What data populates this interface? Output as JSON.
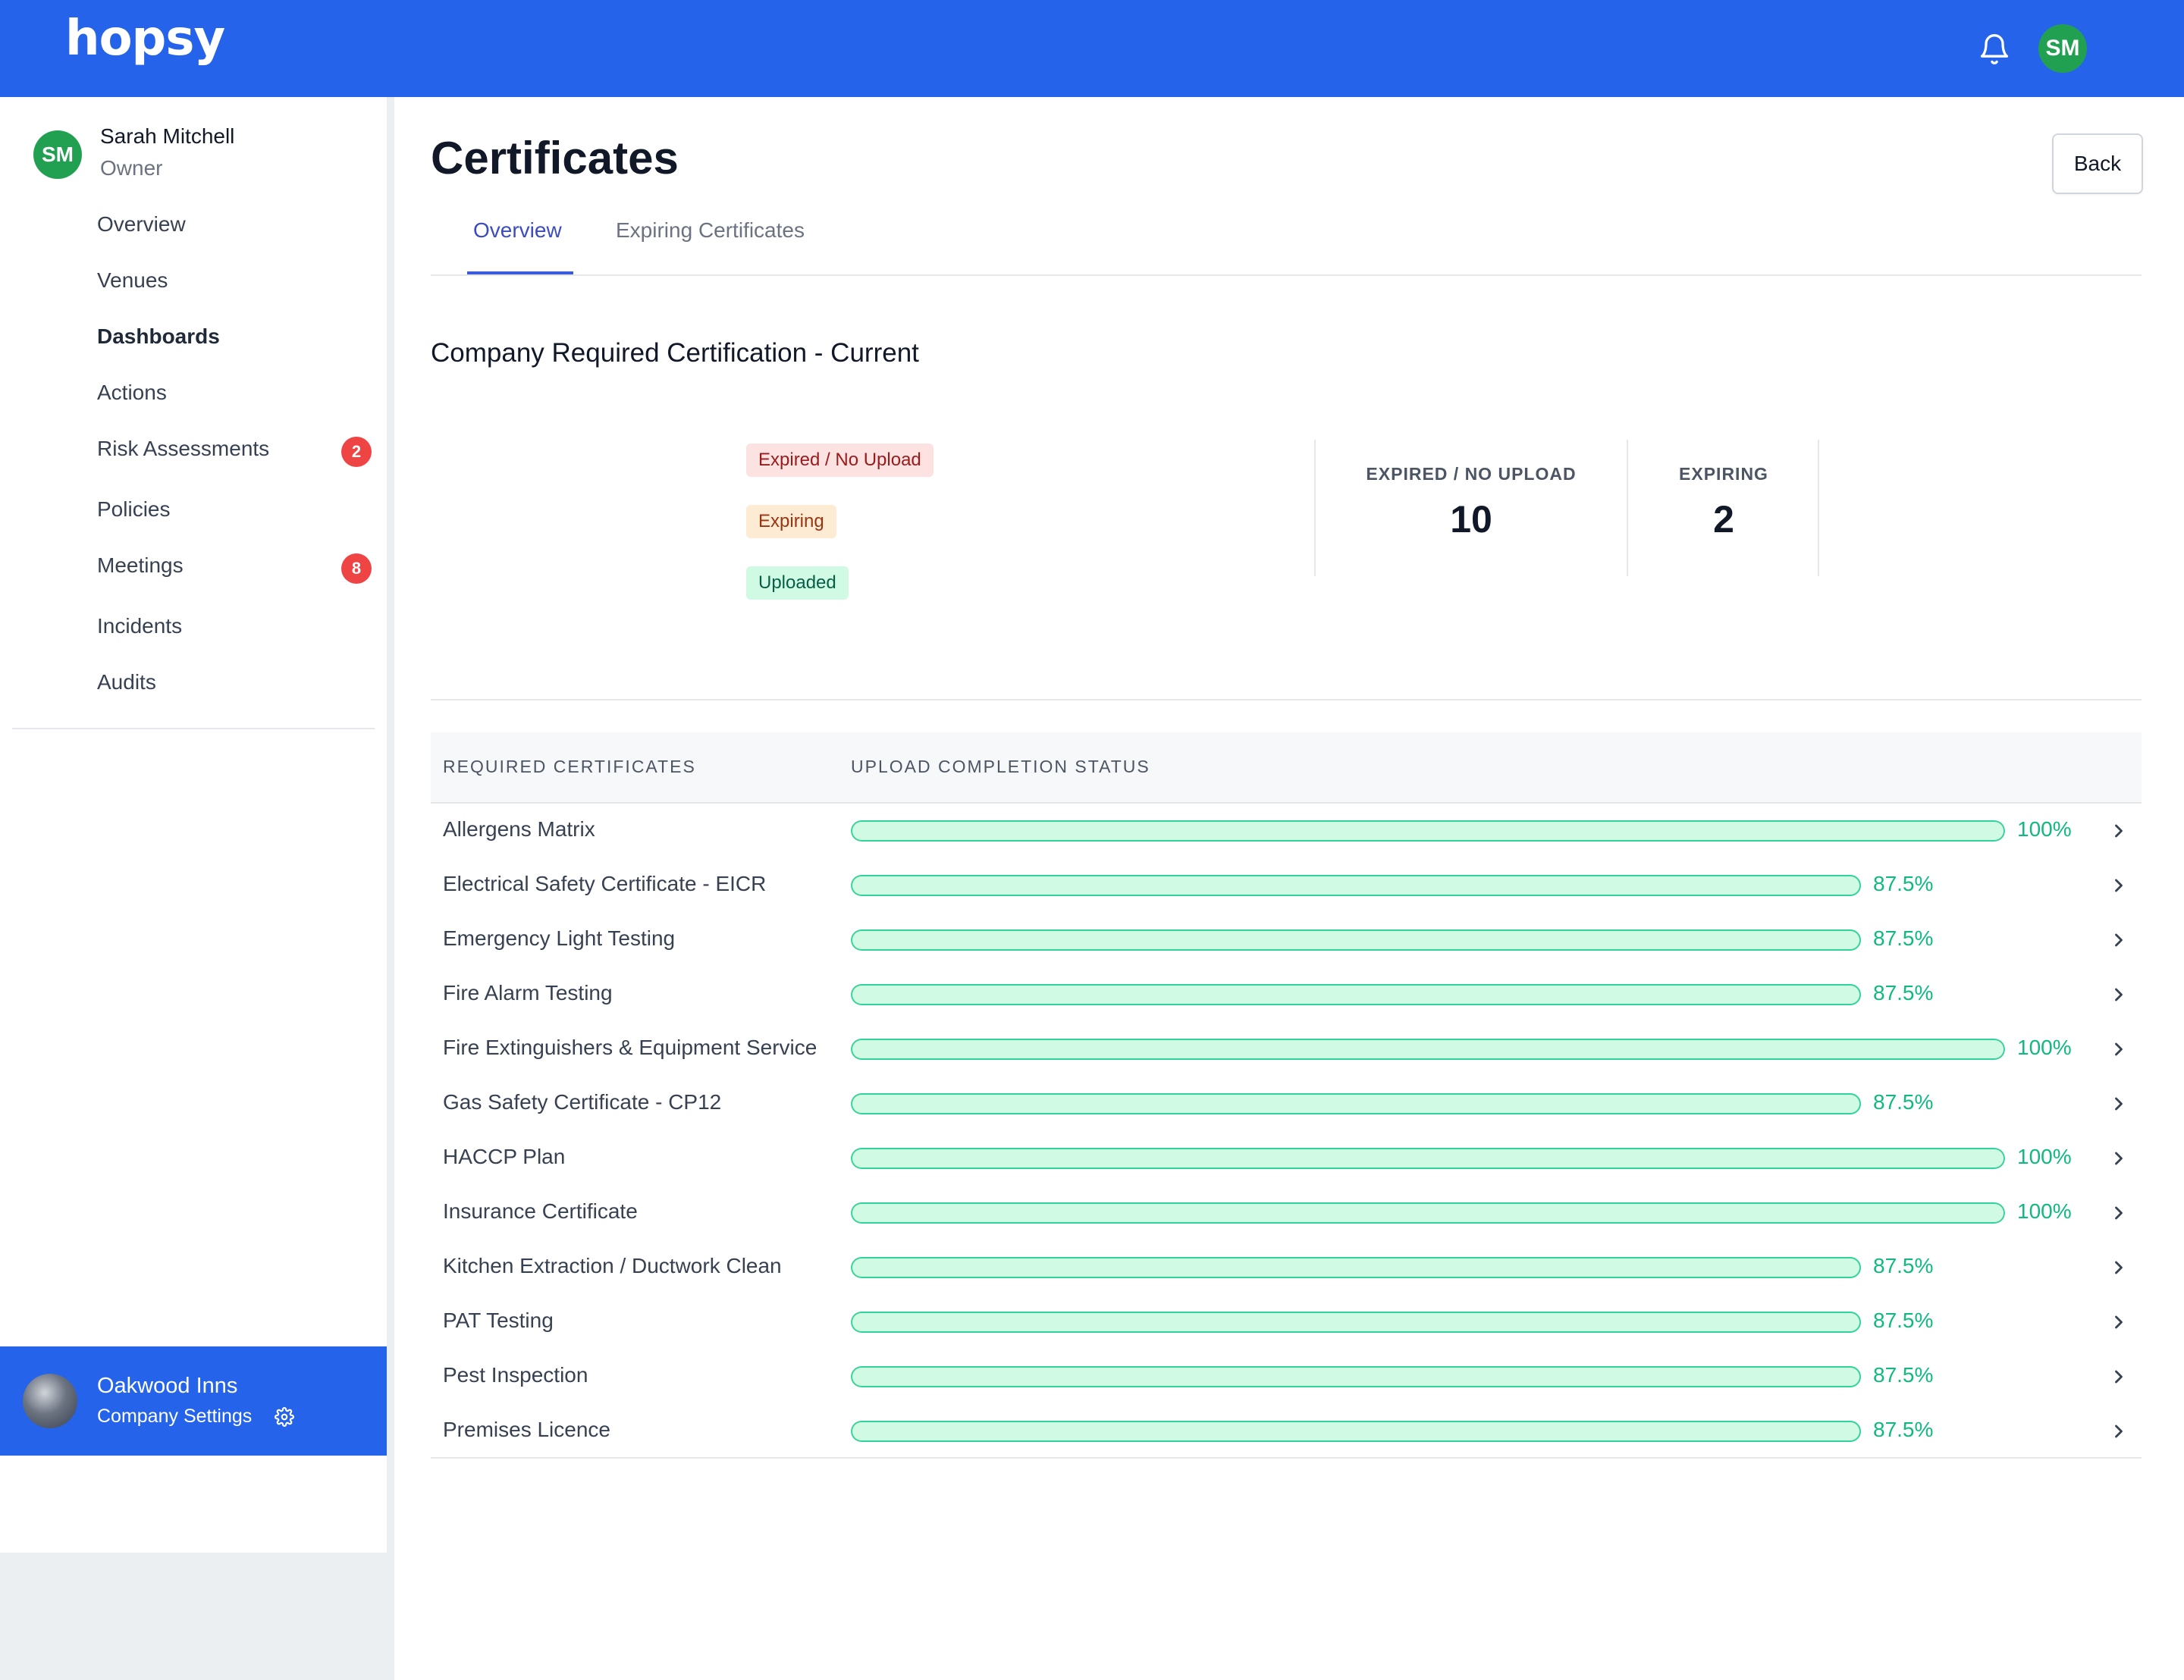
{
  "brand": {
    "logo": "hopsy",
    "primary_color": "#2563eb"
  },
  "topbar": {
    "bell_icon": "bell-icon",
    "avatar_initials": "SM"
  },
  "user": {
    "initials": "SM",
    "name": "Sarah Mitchell",
    "role": "Owner"
  },
  "sidebar": {
    "items": [
      {
        "label": "Overview",
        "active": false
      },
      {
        "label": "Venues",
        "active": false
      },
      {
        "label": "Dashboards",
        "active": true
      },
      {
        "label": "Actions",
        "active": false
      },
      {
        "label": "Risk Assessments",
        "active": false,
        "badge": "2"
      },
      {
        "label": "Policies",
        "active": false
      },
      {
        "label": "Meetings",
        "active": false,
        "badge": "8"
      },
      {
        "label": "Incidents",
        "active": false
      },
      {
        "label": "Audits",
        "active": false
      }
    ],
    "company": {
      "name": "Oakwood Inns",
      "settings_label": "Company Settings"
    }
  },
  "main": {
    "title": "Certificates",
    "back_label": "Back",
    "tabs": [
      {
        "label": "Overview",
        "active": true
      },
      {
        "label": "Expiring Certificates",
        "active": false
      }
    ],
    "section_title": "Company Required Certification - Current",
    "legend": [
      "Expired / No Upload",
      "Expiring",
      "Uploaded"
    ],
    "stats": [
      {
        "label": "EXPIRED / NO UPLOAD",
        "value": "10"
      },
      {
        "label": "EXPIRING",
        "value": "2"
      }
    ],
    "table": {
      "headers": [
        "REQUIRED CERTIFICATES",
        "UPLOAD COMPLETION STATUS"
      ],
      "rows": [
        {
          "name": "Allergens Matrix",
          "percent": 100,
          "label": "100%"
        },
        {
          "name": "Electrical Safety Certificate - EICR",
          "percent": 87.5,
          "label": "87.5%"
        },
        {
          "name": "Emergency Light Testing",
          "percent": 87.5,
          "label": "87.5%"
        },
        {
          "name": "Fire Alarm Testing",
          "percent": 87.5,
          "label": "87.5%"
        },
        {
          "name": "Fire Extinguishers & Equipment Service",
          "percent": 100,
          "label": "100%"
        },
        {
          "name": "Gas Safety Certificate - CP12",
          "percent": 87.5,
          "label": "87.5%"
        },
        {
          "name": "HACCP Plan",
          "percent": 100,
          "label": "100%"
        },
        {
          "name": "Insurance Certificate",
          "percent": 100,
          "label": "100%"
        },
        {
          "name": "Kitchen Extraction / Ductwork Clean",
          "percent": 87.5,
          "label": "87.5%"
        },
        {
          "name": "PAT Testing",
          "percent": 87.5,
          "label": "87.5%"
        },
        {
          "name": "Pest Inspection",
          "percent": 87.5,
          "label": "87.5%"
        },
        {
          "name": "Premises Licence",
          "percent": 87.5,
          "label": "87.5%"
        }
      ]
    }
  }
}
